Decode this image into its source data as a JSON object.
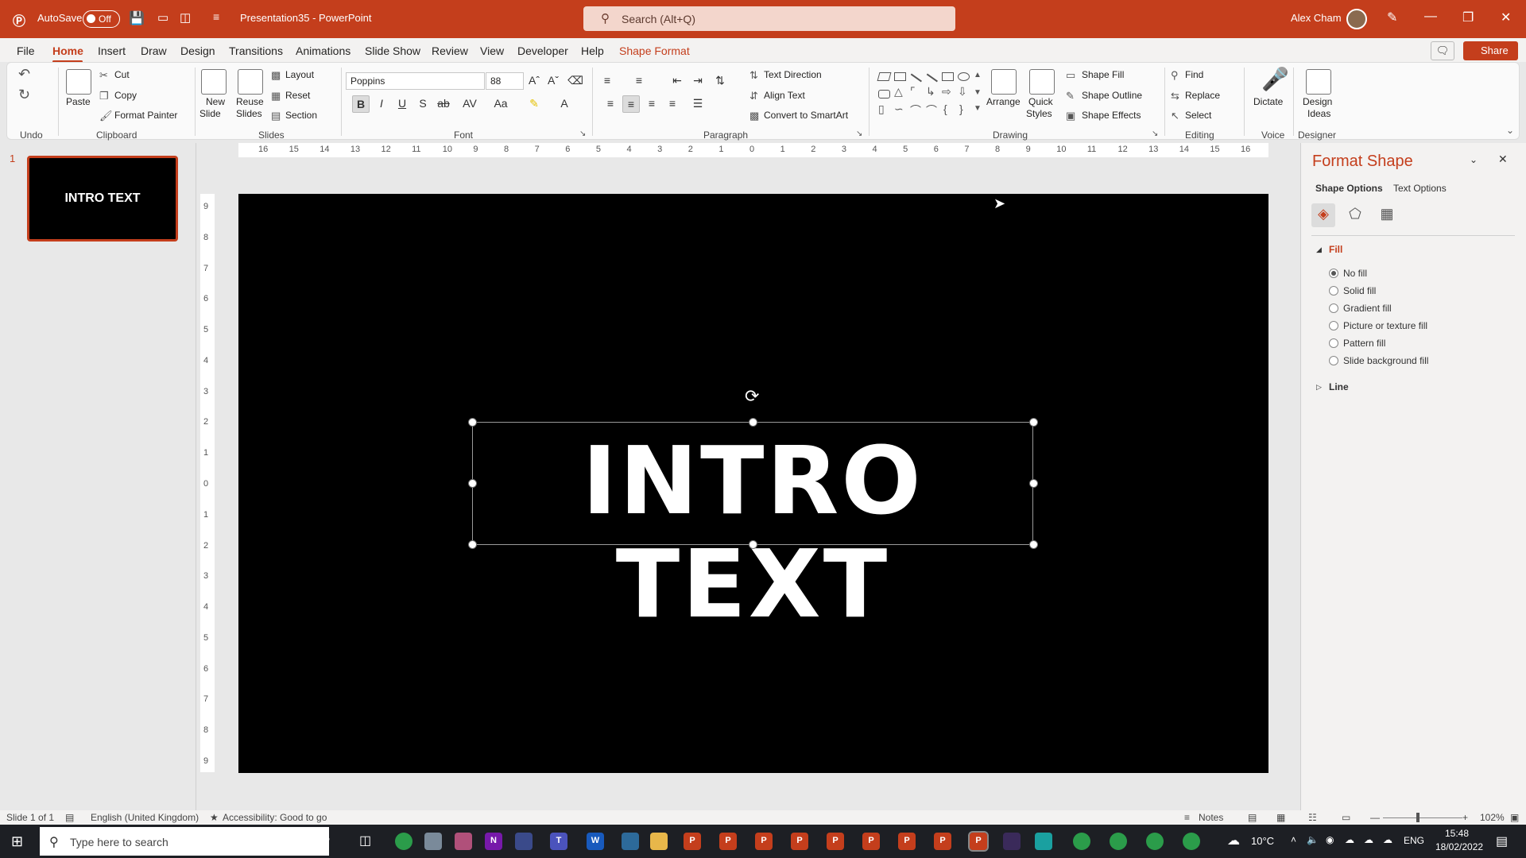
{
  "titlebar": {
    "autosave": "AutoSave",
    "toggle": "Off",
    "doc_title": "Presentation35  -  PowerPoint",
    "search_placeholder": "Search (Alt+Q)",
    "user": "Alex Cham"
  },
  "menu": {
    "items": [
      "File",
      "Home",
      "Insert",
      "Draw",
      "Design",
      "Transitions",
      "Animations",
      "Slide Show",
      "Review",
      "View",
      "Developer",
      "Help",
      "Shape Format"
    ],
    "share": "Share"
  },
  "ribbon": {
    "undo_group": "Undo",
    "clipboard": {
      "paste": "Paste",
      "cut": "Cut",
      "copy": "Copy",
      "format_painter": "Format Painter",
      "group": "Clipboard"
    },
    "slides": {
      "new_slide_1": "New",
      "new_slide_2": "Slide",
      "reuse_1": "Reuse",
      "reuse_2": "Slides",
      "layout": "Layout",
      "reset": "Reset",
      "section": "Section",
      "group": "Slides"
    },
    "font": {
      "name": "Poppins",
      "size": "88",
      "group": "Font",
      "bold": "B",
      "italic": "I",
      "underline": "U",
      "strike": "S",
      "spacing": "AV",
      "case": "Aa"
    },
    "paragraph": {
      "text_direction": "Text Direction",
      "align_text": "Align Text",
      "convert": "Convert to SmartArt",
      "group": "Paragraph"
    },
    "drawing": {
      "arrange": "Arrange",
      "quick_1": "Quick",
      "quick_2": "Styles",
      "shape_fill": "Shape Fill",
      "shape_outline": "Shape Outline",
      "shape_effects": "Shape Effects",
      "group": "Drawing"
    },
    "editing": {
      "find": "Find",
      "replace": "Replace",
      "select": "Select",
      "group": "Editing"
    },
    "voice": {
      "dictate": "Dictate",
      "group": "Voice"
    },
    "designer": {
      "design_1": "Design",
      "design_2": "Ideas",
      "group": "Designer"
    }
  },
  "thumbnails": [
    {
      "number": "1",
      "text": "INTRO TEXT"
    }
  ],
  "hruler": [
    "16",
    "15",
    "14",
    "13",
    "12",
    "11",
    "10",
    "9",
    "8",
    "7",
    "6",
    "5",
    "4",
    "3",
    "2",
    "1",
    "0",
    "1",
    "2",
    "3",
    "4",
    "5",
    "6",
    "7",
    "8",
    "9",
    "10",
    "11",
    "12",
    "13",
    "14",
    "15",
    "16"
  ],
  "vruler": [
    "9",
    "8",
    "7",
    "6",
    "5",
    "4",
    "3",
    "2",
    "1",
    "0",
    "1",
    "2",
    "3",
    "4",
    "5",
    "6",
    "7",
    "8",
    "9"
  ],
  "slide": {
    "text": "INTRO TEXT"
  },
  "format_pane": {
    "title": "Format Shape",
    "tab_shape": "Shape Options",
    "tab_text": "Text Options",
    "fill_header": "Fill",
    "fill_options": [
      "No fill",
      "Solid fill",
      "Gradient fill",
      "Picture or texture fill",
      "Pattern fill",
      "Slide background fill"
    ],
    "selected": "No fill",
    "line_header": "Line"
  },
  "status": {
    "slide": "Slide 1 of 1",
    "language": "English (United Kingdom)",
    "accessibility": "Accessibility: Good to go",
    "notes": "Notes",
    "zoom": "102%"
  },
  "taskbar": {
    "search_placeholder": "Type here to search",
    "temperature": "10°C",
    "lang": "ENG",
    "time": "15:48",
    "date": "18/02/2022"
  },
  "colors": {
    "accent": "#c43e1c",
    "slide_bg": "#000000",
    "text": "#ffffff"
  }
}
